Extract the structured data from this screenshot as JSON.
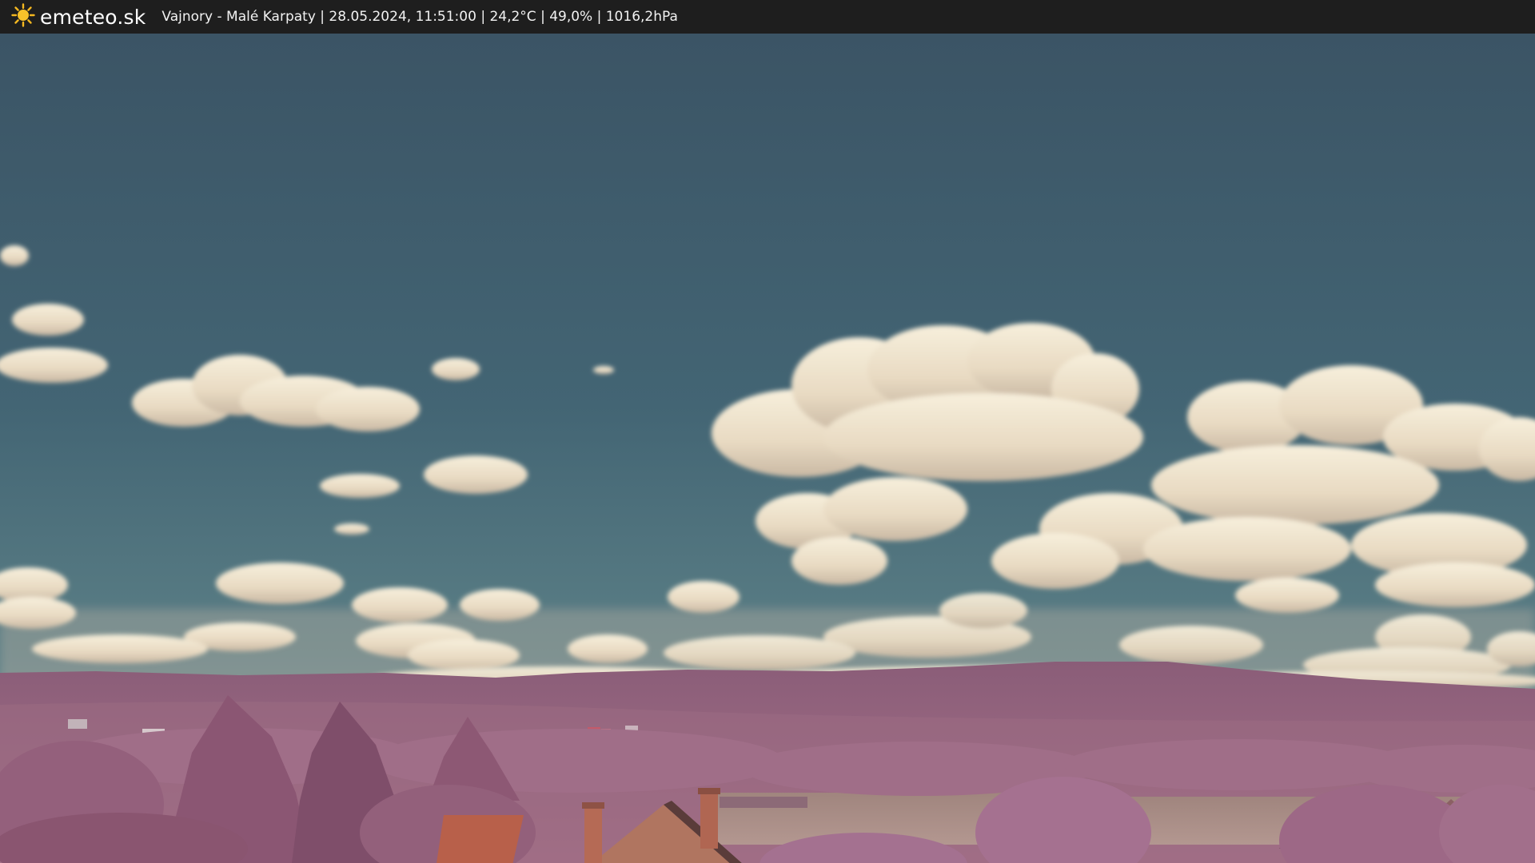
{
  "header": {
    "site_name": "emeteo.sk",
    "logo_icon": "sun-icon",
    "info_line": "Vajnory - Malé Karpaty | 28.05.2024, 11:51:00 | 24,2°C | 49,0% | 1016,2hPa"
  },
  "colors": {
    "bar_background": "#1e1e1e",
    "sun_yellow": "#f5b820",
    "sky_top": "#3c5a6b",
    "sky_bottom": "#6a8d92",
    "cloud": "#ebe0cb",
    "foliage": "#9a6480",
    "roof": "#b86a4e"
  }
}
